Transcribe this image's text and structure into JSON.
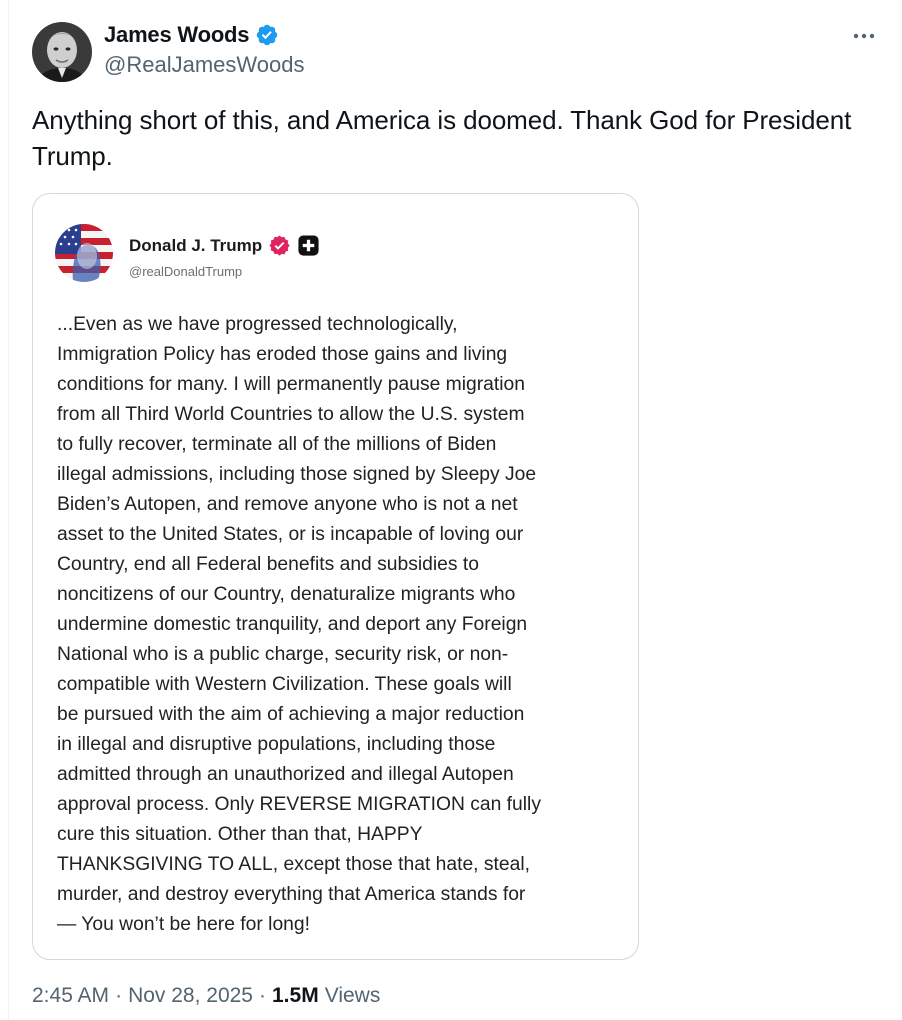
{
  "author": {
    "name": "James Woods",
    "handle": "@RealJamesWoods"
  },
  "tweet": {
    "text": "Anything short of this, and America is doomed. Thank God for President Trump."
  },
  "quoted": {
    "name": "Donald J. Trump",
    "handle": "@realDonaldTrump",
    "lines": [
      "...Even as we have progressed technologically,",
      "Immigration Policy has eroded those gains and living",
      "conditions for many. I will permanently pause migration",
      "from all Third World Countries to allow the U.S. system",
      "to fully recover, terminate all of the millions of Biden",
      "illegal admissions, including those signed by Sleepy Joe",
      "Biden’s Autopen, and remove anyone who is not a net",
      "asset to the United States, or is incapable of loving our",
      "Country, end all Federal benefits and subsidies to",
      "noncitizens of our Country, denaturalize migrants who",
      "undermine domestic tranquility, and deport any Foreign",
      "National who is a public charge, security risk, or non-",
      "compatible with Western Civilization. These goals will",
      "be pursued with the aim of achieving a major reduction",
      "in illegal and disruptive populations, including those",
      "admitted through an unauthorized and illegal Autopen",
      "approval process. Only REVERSE MIGRATION can fully",
      "cure this situation. Other than that, HAPPY",
      "THANKSGIVING TO ALL, except those that hate, steal,",
      "murder, and destroy everything that America stands for",
      "— You won’t be here for long!"
    ]
  },
  "meta": {
    "time": "2:45 AM",
    "separator": "·",
    "date": "Nov 28, 2025",
    "views_count": "1.5M",
    "views_label": "Views"
  },
  "colors": {
    "verified_blue": "#1d9bf0",
    "truth_badge_pink": "#e0245e",
    "secondary_text": "#536471",
    "border": "#cfd9de"
  },
  "icons": {
    "verified": "verified-badge-icon",
    "more": "more-options-icon",
    "truth_badge": "truth-verified-badge-icon",
    "plus": "plus-badge-icon"
  }
}
